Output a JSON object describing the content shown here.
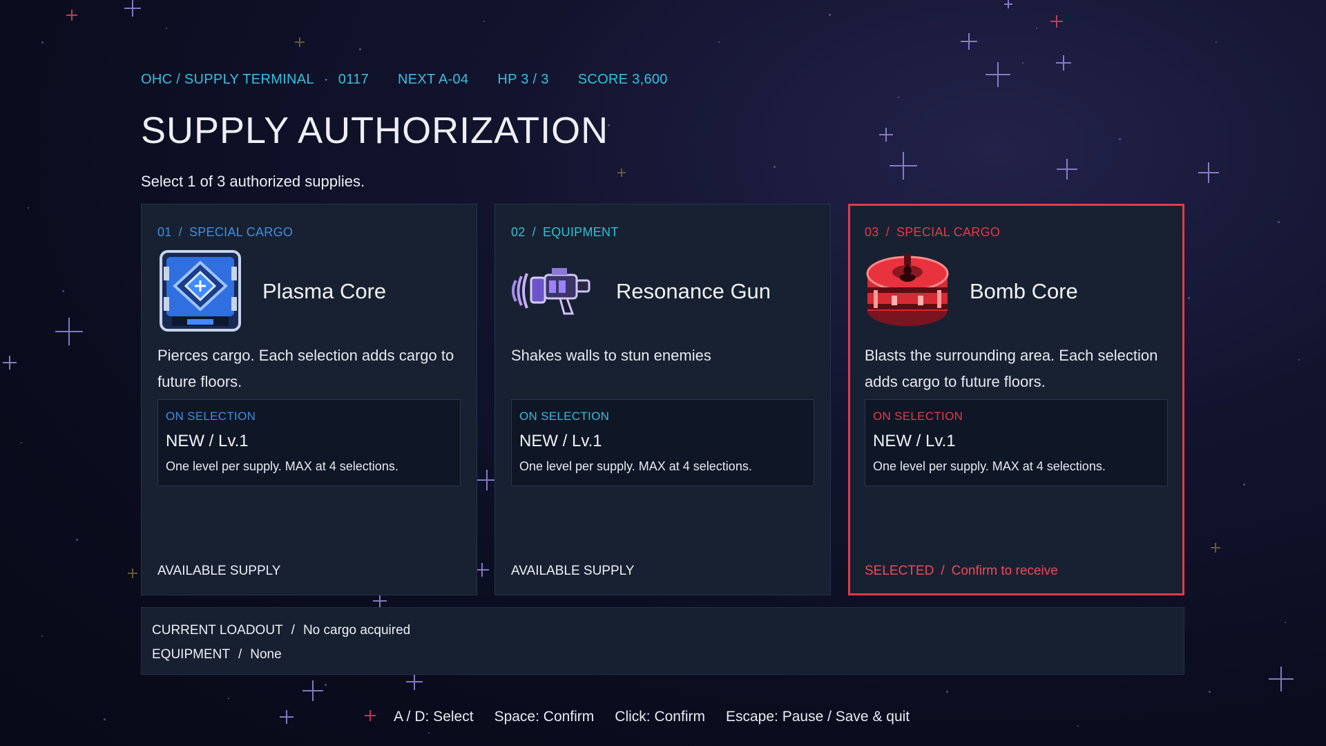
{
  "header": {
    "location": "OHC / SUPPLY TERMINAL",
    "run_id": "0117",
    "next_stage": "NEXT A-04",
    "hp": "HP 3 / 3",
    "score": "SCORE 3,600"
  },
  "title": "SUPPLY AUTHORIZATION",
  "subtitle": "Select 1 of 3 authorized supplies.",
  "cards": [
    {
      "index": "01",
      "category": "SPECIAL CARGO",
      "icon": "plasma-core-icon",
      "name": "Plasma Core",
      "description": "Pierces cargo. Each selection adds cargo to future floors.",
      "effect_label": "ON SELECTION",
      "effect_level": "NEW / Lv.1",
      "effect_note": "One level per supply. MAX at 4 selections.",
      "footer": "AVAILABLE SUPPLY",
      "accent": "#3d8fe6"
    },
    {
      "index": "02",
      "category": "EQUIPMENT",
      "icon": "resonance-gun-icon",
      "name": "Resonance Gun",
      "description": "Shakes walls to stun enemies",
      "effect_label": "ON SELECTION",
      "effect_level": "NEW / Lv.1",
      "effect_note": "One level per supply. MAX at 4 selections.",
      "footer": "AVAILABLE SUPPLY",
      "accent": "#2fc0d8"
    },
    {
      "index": "03",
      "category": "SPECIAL CARGO",
      "icon": "bomb-core-icon",
      "name": "Bomb Core",
      "description": "Blasts the surrounding area. Each selection adds cargo to future floors.",
      "effect_label": "ON SELECTION",
      "effect_level": "NEW / Lv.1",
      "effect_note": "One level per supply. MAX at 4 selections.",
      "footer_status": "SELECTED",
      "footer_action": "Confirm to receive",
      "accent": "#e8394a",
      "selected": true
    }
  ],
  "loadout": {
    "cargo_label": "CURRENT LOADOUT",
    "cargo_value": "No cargo acquired",
    "equipment_label": "EQUIPMENT",
    "equipment_value": "None"
  },
  "controls": {
    "select": "A / D: Select",
    "confirm_key": "Space: Confirm",
    "confirm_click": "Click: Confirm",
    "pause": "Escape: Pause / Save & quit"
  },
  "colors": {
    "header_text": "#35c1e0",
    "selected_border": "#e8394a"
  }
}
